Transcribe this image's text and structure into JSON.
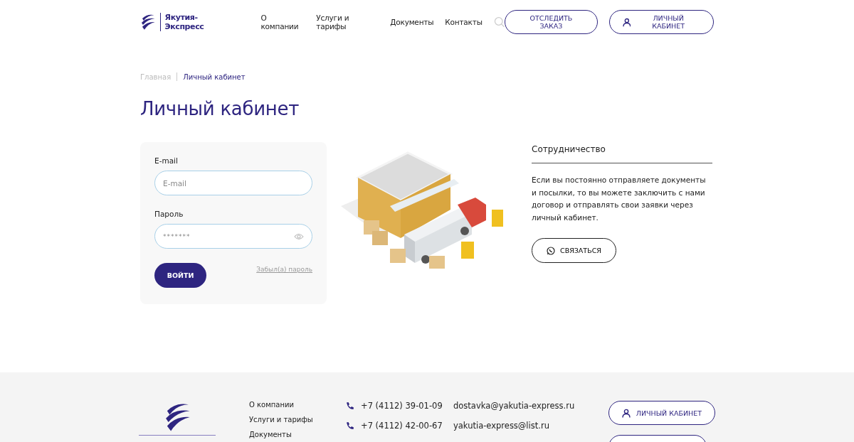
{
  "header": {
    "logo_text": "Якутия-Экспресс",
    "nav": [
      {
        "label": "О компании"
      },
      {
        "label": "Услуги и тарифы"
      },
      {
        "label": "Документы"
      },
      {
        "label": "Контакты"
      }
    ],
    "track_button": "ОТСЛЕДИТЬ ЗАКАЗ",
    "account_button": "ЛИЧНЫЙ КАБИНЕТ"
  },
  "breadcrumbs": [
    {
      "label": "Главная",
      "selected": false
    },
    {
      "label": "Личный кабинет",
      "selected": true
    }
  ],
  "page_title": "Личный кабинет",
  "login": {
    "email_label": "E-mail",
    "email_placeholder": "E-mail",
    "password_label": "Пароль",
    "password_value": "*******",
    "submit": "ВОЙТИ",
    "forgot_link": "Забыл(а) пароль"
  },
  "cooperation": {
    "title": "Сотрудничество",
    "text": "Если вы постоянно отправляете документы и посылки, то вы можете заключить с нами договор и отправлять свои заявки через личный кабинет.",
    "button": "СВЯЗАТЬСЯ"
  },
  "footer": {
    "links": [
      {
        "label": "О компании"
      },
      {
        "label": "Услуги и тарифы"
      },
      {
        "label": "Документы"
      }
    ],
    "phones": [
      "+7 (4112) 39-01-09",
      "+7 (4112) 42-00-67"
    ],
    "emails": [
      "dostavka@yakutia-express.ru",
      "yakutia-express@list.ru"
    ],
    "account_button": "ЛИЧНЫЙ КАБИНЕТ"
  }
}
